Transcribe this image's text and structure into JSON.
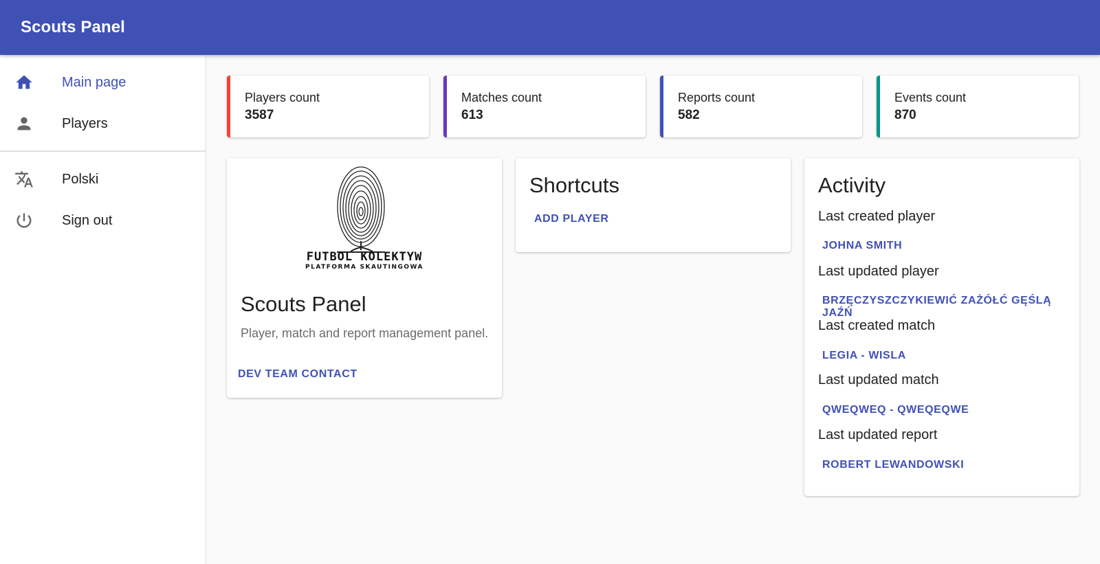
{
  "appbar": {
    "title": "Scouts Panel"
  },
  "sidebar": {
    "items": [
      {
        "label": "Main page",
        "icon": "home-icon",
        "active": true
      },
      {
        "label": "Players",
        "icon": "person-icon"
      },
      {
        "label": "Polski",
        "icon": "translate-icon"
      },
      {
        "label": "Sign out",
        "icon": "power-icon"
      }
    ]
  },
  "stats": [
    {
      "label": "Players count",
      "value": "3587",
      "color": "#f44336"
    },
    {
      "label": "Matches count",
      "value": "613",
      "color": "#673ab7"
    },
    {
      "label": "Reports count",
      "value": "582",
      "color": "#3f51b5"
    },
    {
      "label": "Events count",
      "value": "870",
      "color": "#009688"
    }
  ],
  "about": {
    "logo_text": "FUTBOL KOLEKTYW",
    "logo_subtext": "PLATFORMA SKAUTINGOWA",
    "title": "Scouts Panel",
    "description": "Player, match and report management panel.",
    "contact_button": "Dev team contact"
  },
  "shortcuts": {
    "title": "Shortcuts",
    "add_player": "Add player"
  },
  "activity": {
    "title": "Activity",
    "entries": [
      {
        "label": "Last created player",
        "link": "Johna Smith"
      },
      {
        "label": "Last updated player",
        "link": "Brzęczyszczykiewić Zażółć Gęślą Jaźń"
      },
      {
        "label": "Last created match",
        "link": "Legia - Wisla"
      },
      {
        "label": "Last updated match",
        "link": "qweqweq - qweqeqwe"
      },
      {
        "label": "Last updated report",
        "link": "Robert Lewandowski"
      }
    ]
  },
  "colors": {
    "primary": "#3f51b5",
    "accent_text": "#3f51b5"
  }
}
